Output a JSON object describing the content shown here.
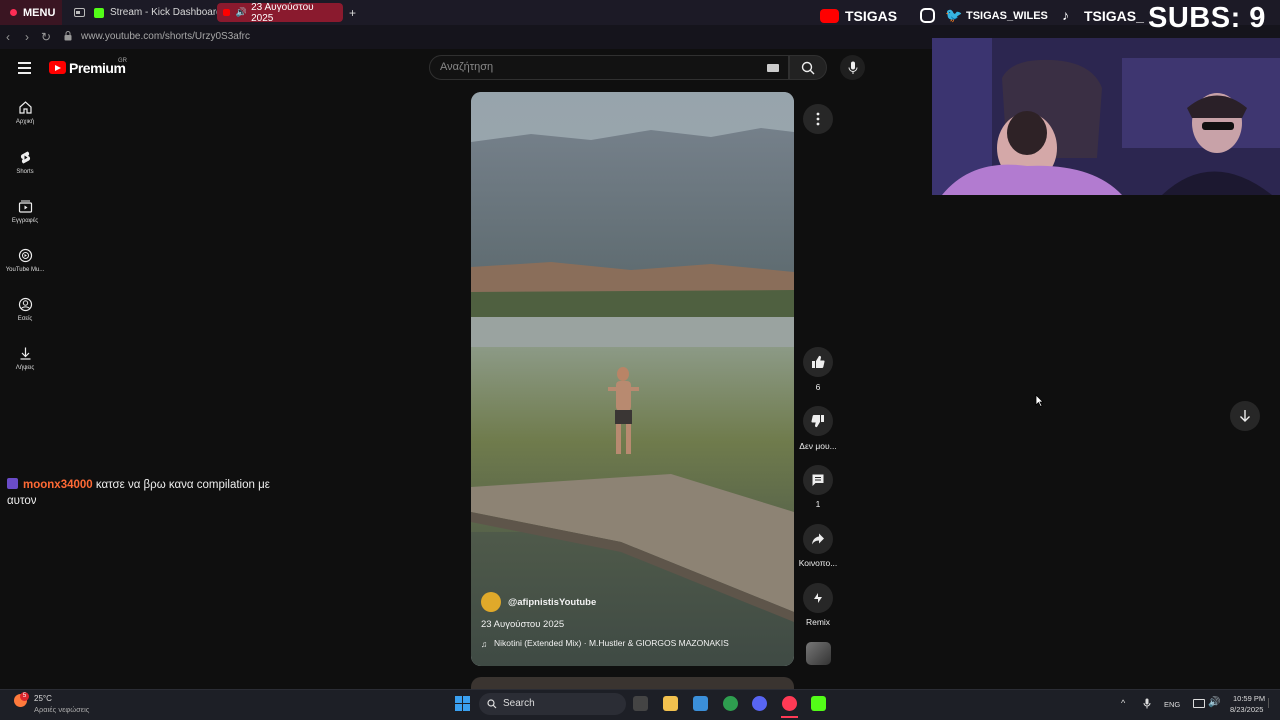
{
  "browser": {
    "menu_label": "MENU",
    "tabs": [
      {
        "label": "Stream - Kick Dashboard"
      },
      {
        "label": "23 Αυγούστου 2025"
      }
    ],
    "new_tab_label": "+",
    "url": "www.youtube.com/shorts/Urzy0S3afrc"
  },
  "header": {
    "brand": "Premium",
    "region": "GR",
    "search_placeholder": "Αναζήτηση"
  },
  "sidebar": {
    "items": [
      {
        "label": "Αρχική",
        "icon": "home-icon"
      },
      {
        "label": "Shorts",
        "icon": "shorts-icon"
      },
      {
        "label": "Εγγραφές",
        "icon": "subscriptions-icon"
      },
      {
        "label": "YouTube Mu...",
        "icon": "youtube-music-icon"
      },
      {
        "label": "Εσείς",
        "icon": "you-icon"
      },
      {
        "label": "Λήψεις",
        "icon": "download-icon"
      }
    ]
  },
  "chat": {
    "username": "moonx34000",
    "message": "κατσε να βρω κανα compilation με αυτον"
  },
  "video": {
    "channel": "@afipnistisYoutube",
    "date": "23 Αυγούστου 2025",
    "music": "Nikotini (Extended Mix) · M.Hustler & GIORGOS MAZONAKIS"
  },
  "actions": {
    "like_count": "6",
    "dislike_label": "Δεν μου...",
    "comment_count": "1",
    "share_label": "Κοινοπο...",
    "remix_label": "Remix"
  },
  "stream_overlay": {
    "youtube": "TSIGAS",
    "twitter": "TSIGAS_WILES",
    "tiktok": "TSIGAS_",
    "subs": "SUBS: 9"
  },
  "taskbar": {
    "weather_badge": "5",
    "temperature": "25°C",
    "weather_desc": "Αραιές νεφώσεις",
    "search_label": "Search",
    "language": "ENG",
    "time": "10:59 PM",
    "date": "8/23/2025"
  },
  "colors": {
    "accent_red": "#ff0000",
    "chat_user": "#ff6a35",
    "background": "#0f0f0f"
  }
}
